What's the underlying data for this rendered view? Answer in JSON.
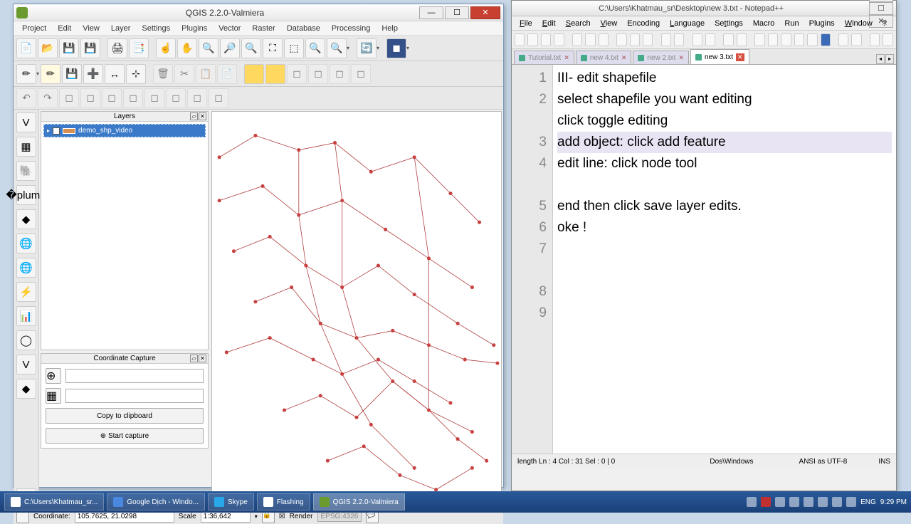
{
  "qgis": {
    "title": "QGIS 2.2.0-Valmiera",
    "menu": [
      "Project",
      "Edit",
      "View",
      "Layer",
      "Settings",
      "Plugins",
      "Vector",
      "Raster",
      "Database",
      "Processing",
      "Help"
    ],
    "layers_panel_title": "Layers",
    "layer_name": "demo_shp_video",
    "coord_panel_title": "Coordinate Capture",
    "copy_btn": "Copy to clipboard",
    "start_btn": "Start capture",
    "status": {
      "coord_label": "Coordinate:",
      "coord_value": "105.7625, 21.0298",
      "scale_label": "Scale",
      "scale_value": "1:36,642",
      "render_label": "Render",
      "epsg": "EPSG:4326"
    }
  },
  "npp": {
    "title": "C:\\Users\\Khatmau_sr\\Desktop\\new 3.txt - Notepad++",
    "menu": [
      "File",
      "Edit",
      "Search",
      "View",
      "Encoding",
      "Language",
      "Settings",
      "Macro",
      "Run",
      "Plugins",
      "Window",
      "?"
    ],
    "tabs": [
      "Tutorial.txt",
      "new  4.txt",
      "new  2.txt",
      "new  3.txt"
    ],
    "active_tab": 3,
    "lines": [
      "III- edit shapefile",
      "select shapefile you want editing",
      "click toggle editing",
      "add object: click add feature",
      "edit line: click node tool",
      "",
      "end then click save layer edits.",
      "oke !",
      ""
    ],
    "hl_line": 3,
    "status": {
      "length": "length   Ln : 4    Col : 31    Sel : 0 | 0",
      "eol": "Dos\\Windows",
      "enc": "ANSI as UTF-8",
      "mode": "INS"
    }
  },
  "taskbar": {
    "items": [
      "C:\\Users\\Khatmau_sr...",
      "Google Dịch - Windo...",
      "Skype",
      "Flashing",
      "QGIS 2.2.0-Valmiera"
    ],
    "lang": "ENG",
    "time": "9:29 PM"
  }
}
